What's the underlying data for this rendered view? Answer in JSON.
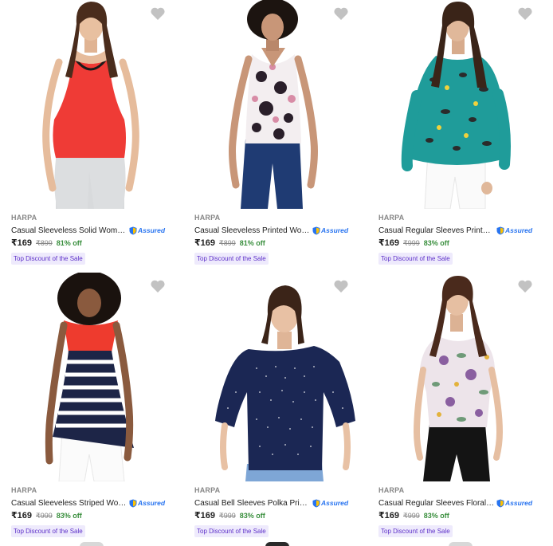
{
  "accent_colors": {
    "discount": "#388e3c",
    "badge_text": "#5e31c9",
    "badge_bg": "#eeeafc",
    "assured": "#2874f0"
  },
  "products": [
    {
      "brand": "HARPA",
      "title": "Casual Sleeveless Solid Women ...",
      "assured": "Assured",
      "price": "₹169",
      "mrp": "₹899",
      "discount": "81% off",
      "badge": "Top Discount of the Sale",
      "image": "red-tank-top-photo"
    },
    {
      "brand": "HARPA",
      "title": "Casual Sleeveless Printed Wome...",
      "assured": "Assured",
      "price": "₹169",
      "mrp": "₹899",
      "discount": "81% off",
      "badge": "Top Discount of the Sale",
      "image": "floral-sleeveless-top-photo"
    },
    {
      "brand": "HARPA",
      "title": "Casual Regular Sleeves Printed ...",
      "assured": "Assured",
      "price": "₹169",
      "mrp": "₹999",
      "discount": "83% off",
      "badge": "Top Discount of the Sale",
      "image": "teal-bird-print-top-photo"
    },
    {
      "brand": "HARPA",
      "title": "Casual Sleeveless Striped Wome...",
      "assured": "Assured",
      "price": "₹169",
      "mrp": "₹999",
      "discount": "83% off",
      "badge": "Top Discount of the Sale",
      "image": "striped-colorblock-top-photo"
    },
    {
      "brand": "HARPA",
      "title": "Casual Bell Sleeves Polka Print ...",
      "assured": "Assured",
      "price": "₹169",
      "mrp": "₹999",
      "discount": "83% off",
      "badge": "Top Discount of the Sale",
      "image": "navy-polka-bell-sleeve-top-photo"
    },
    {
      "brand": "HARPA",
      "title": "Casual Regular Sleeves Floral Pri...",
      "assured": "Assured",
      "price": "₹169",
      "mrp": "₹999",
      "discount": "83% off",
      "badge": "Top Discount of the Sale",
      "image": "floral-cold-shoulder-top-photo"
    }
  ]
}
